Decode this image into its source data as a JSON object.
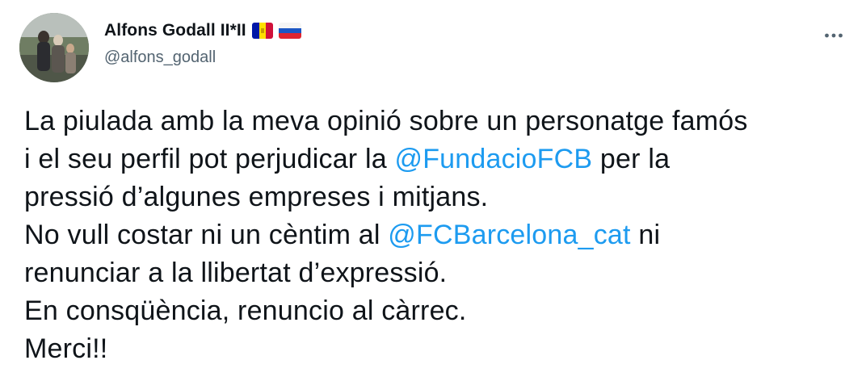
{
  "author": {
    "display_name": "Alfons Godall II*II",
    "handle": "@alfons_godall",
    "flags": [
      "andorra-flag-icon",
      "russia-flag-icon"
    ]
  },
  "menu": {
    "icon": "more-horizontal-icon"
  },
  "tweet": {
    "line1": "La piulada amb la meva opinió sobre un personatge famós",
    "line2_before": "i el seu perfil pot perjudicar la ",
    "line2_mention": "@FundacioFCB",
    "line2_after": " per la",
    "line3": "pressió d’algunes empreses i mitjans.",
    "line4_before": "No vull costar ni un cèntim al ",
    "line4_mention": "@FCBarcelona_cat",
    "line4_after": " ni",
    "line5": "renunciar a la llibertat d’expressió.",
    "line6": "En consqüència, renuncio al càrrec.",
    "line7": "Merci!!"
  },
  "colors": {
    "text": "#0f1419",
    "secondary": "#536471",
    "link": "#1d9bf0",
    "background": "#ffffff"
  }
}
